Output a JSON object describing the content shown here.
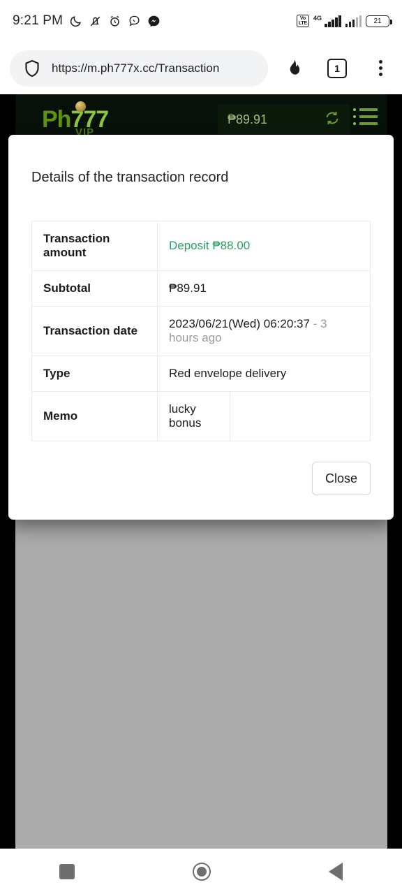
{
  "statusbar": {
    "clock": "9:21 PM",
    "icons": [
      "moon-icon",
      "mute-vibrate-icon",
      "alarm-icon",
      "viber-icon",
      "messenger-icon"
    ],
    "volte": "VoLTE",
    "network": "4G",
    "battery": "21"
  },
  "browser": {
    "url": "https://m.ph777x.cc/Transaction",
    "shield_icon": "shield-icon",
    "flame_icon": "flame-icon",
    "tab_count": "1",
    "menu_icon": "three-dot-menu-icon"
  },
  "site": {
    "logo_prefix": "Ph",
    "logo_suffix": "777",
    "logo_vip": "VIP",
    "balance": "₱89.91",
    "refresh_icon": "refresh-icon",
    "menu_icon": "hamburger-menu-icon"
  },
  "dialog": {
    "title": "Details of the transaction record",
    "rows": [
      {
        "label": "Transaction amount",
        "value": "Deposit ₱88.00",
        "value_color": "#2f9c66"
      },
      {
        "label": "Subtotal",
        "value": "₱89.91"
      },
      {
        "label": "Transaction date",
        "value": "2023/06/21(Wed) 06:20:37",
        "suffix": " - 3 hours ago"
      },
      {
        "label": "Type",
        "value": "Red envelope delivery"
      },
      {
        "label": "Memo",
        "value": "lucky bonus",
        "extra": ""
      }
    ],
    "close_label": "Close"
  },
  "navbar": {
    "recents": "recents-icon",
    "home": "home-icon",
    "back": "back-icon"
  }
}
